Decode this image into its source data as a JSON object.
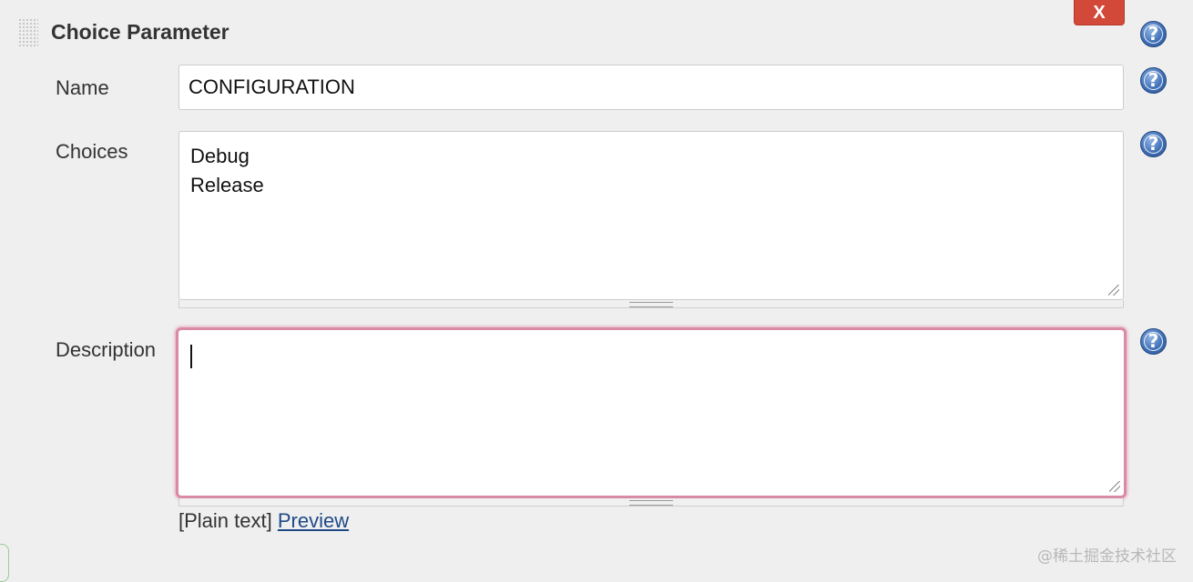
{
  "section": {
    "title": "Choice Parameter",
    "delete_label": "X"
  },
  "help_icon_glyph": "?",
  "fields": {
    "name": {
      "label": "Name",
      "value": "CONFIGURATION"
    },
    "choices": {
      "label": "Choices",
      "lines": [
        "Debug",
        "Release"
      ]
    },
    "description": {
      "label": "Description",
      "value": ""
    }
  },
  "format": {
    "plain_text": "[Plain text]",
    "preview_link": "Preview"
  },
  "watermark": "@稀土掘金技术社区",
  "colors": {
    "delete_button": "#d24939",
    "focus_border": "#d98aa6",
    "help_icon": "#3f6fb6",
    "link": "#204a87"
  },
  "icons": {
    "drag_handle": "drag-handle-icon",
    "delete": "close-icon",
    "help": "help-icon"
  }
}
